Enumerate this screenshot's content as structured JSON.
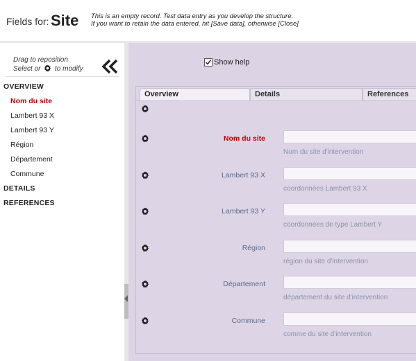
{
  "header": {
    "fields_for": "Fields for:",
    "record_name": "Site",
    "note_line1": "This is an empty record. Test data entry as you develop the structure.",
    "note_line2": "If you want to retain the data entered, hit [Save data], otherwise [Close]"
  },
  "sidebar": {
    "hint_line1": "Drag to reposition",
    "hint_select": "Select or",
    "hint_modify": "to modify",
    "nav": [
      {
        "label": "OVERVIEW",
        "type": "section"
      },
      {
        "label": "Nom du site",
        "type": "field",
        "active": true
      },
      {
        "label": "Lambert 93 X",
        "type": "field"
      },
      {
        "label": "Lambert 93 Y",
        "type": "field"
      },
      {
        "label": "Région",
        "type": "field"
      },
      {
        "label": "Département",
        "type": "field"
      },
      {
        "label": "Commune",
        "type": "field"
      },
      {
        "label": "DETAILS",
        "type": "section"
      },
      {
        "label": "REFERENCES",
        "type": "section"
      }
    ]
  },
  "main": {
    "show_help_label": "Show help",
    "show_help_checked": true,
    "tabs": [
      {
        "label": "Overview",
        "active": true
      },
      {
        "label": "Details"
      },
      {
        "label": "References"
      }
    ],
    "fields": [
      {
        "label": "Nom du site",
        "required": true,
        "value": "",
        "help": "Nom du site d'intervention"
      },
      {
        "label": "Lambert 93 X",
        "value": "",
        "help": "coordonnées Lambert 93 X"
      },
      {
        "label": "Lambert 93 Y",
        "value": "",
        "help": "coordonnées de type Lambert Y"
      },
      {
        "label": "Région",
        "value": "",
        "help": "région du site d'intervention"
      },
      {
        "label": "Département",
        "value": "",
        "help": "département du site d'intervention"
      },
      {
        "label": "Commune",
        "value": "",
        "help": "comme du site d'intervention"
      }
    ]
  },
  "colors": {
    "accent_required": "#c00000",
    "panel_bg": "#dcd3e5",
    "label_color": "#5a6a8a"
  }
}
